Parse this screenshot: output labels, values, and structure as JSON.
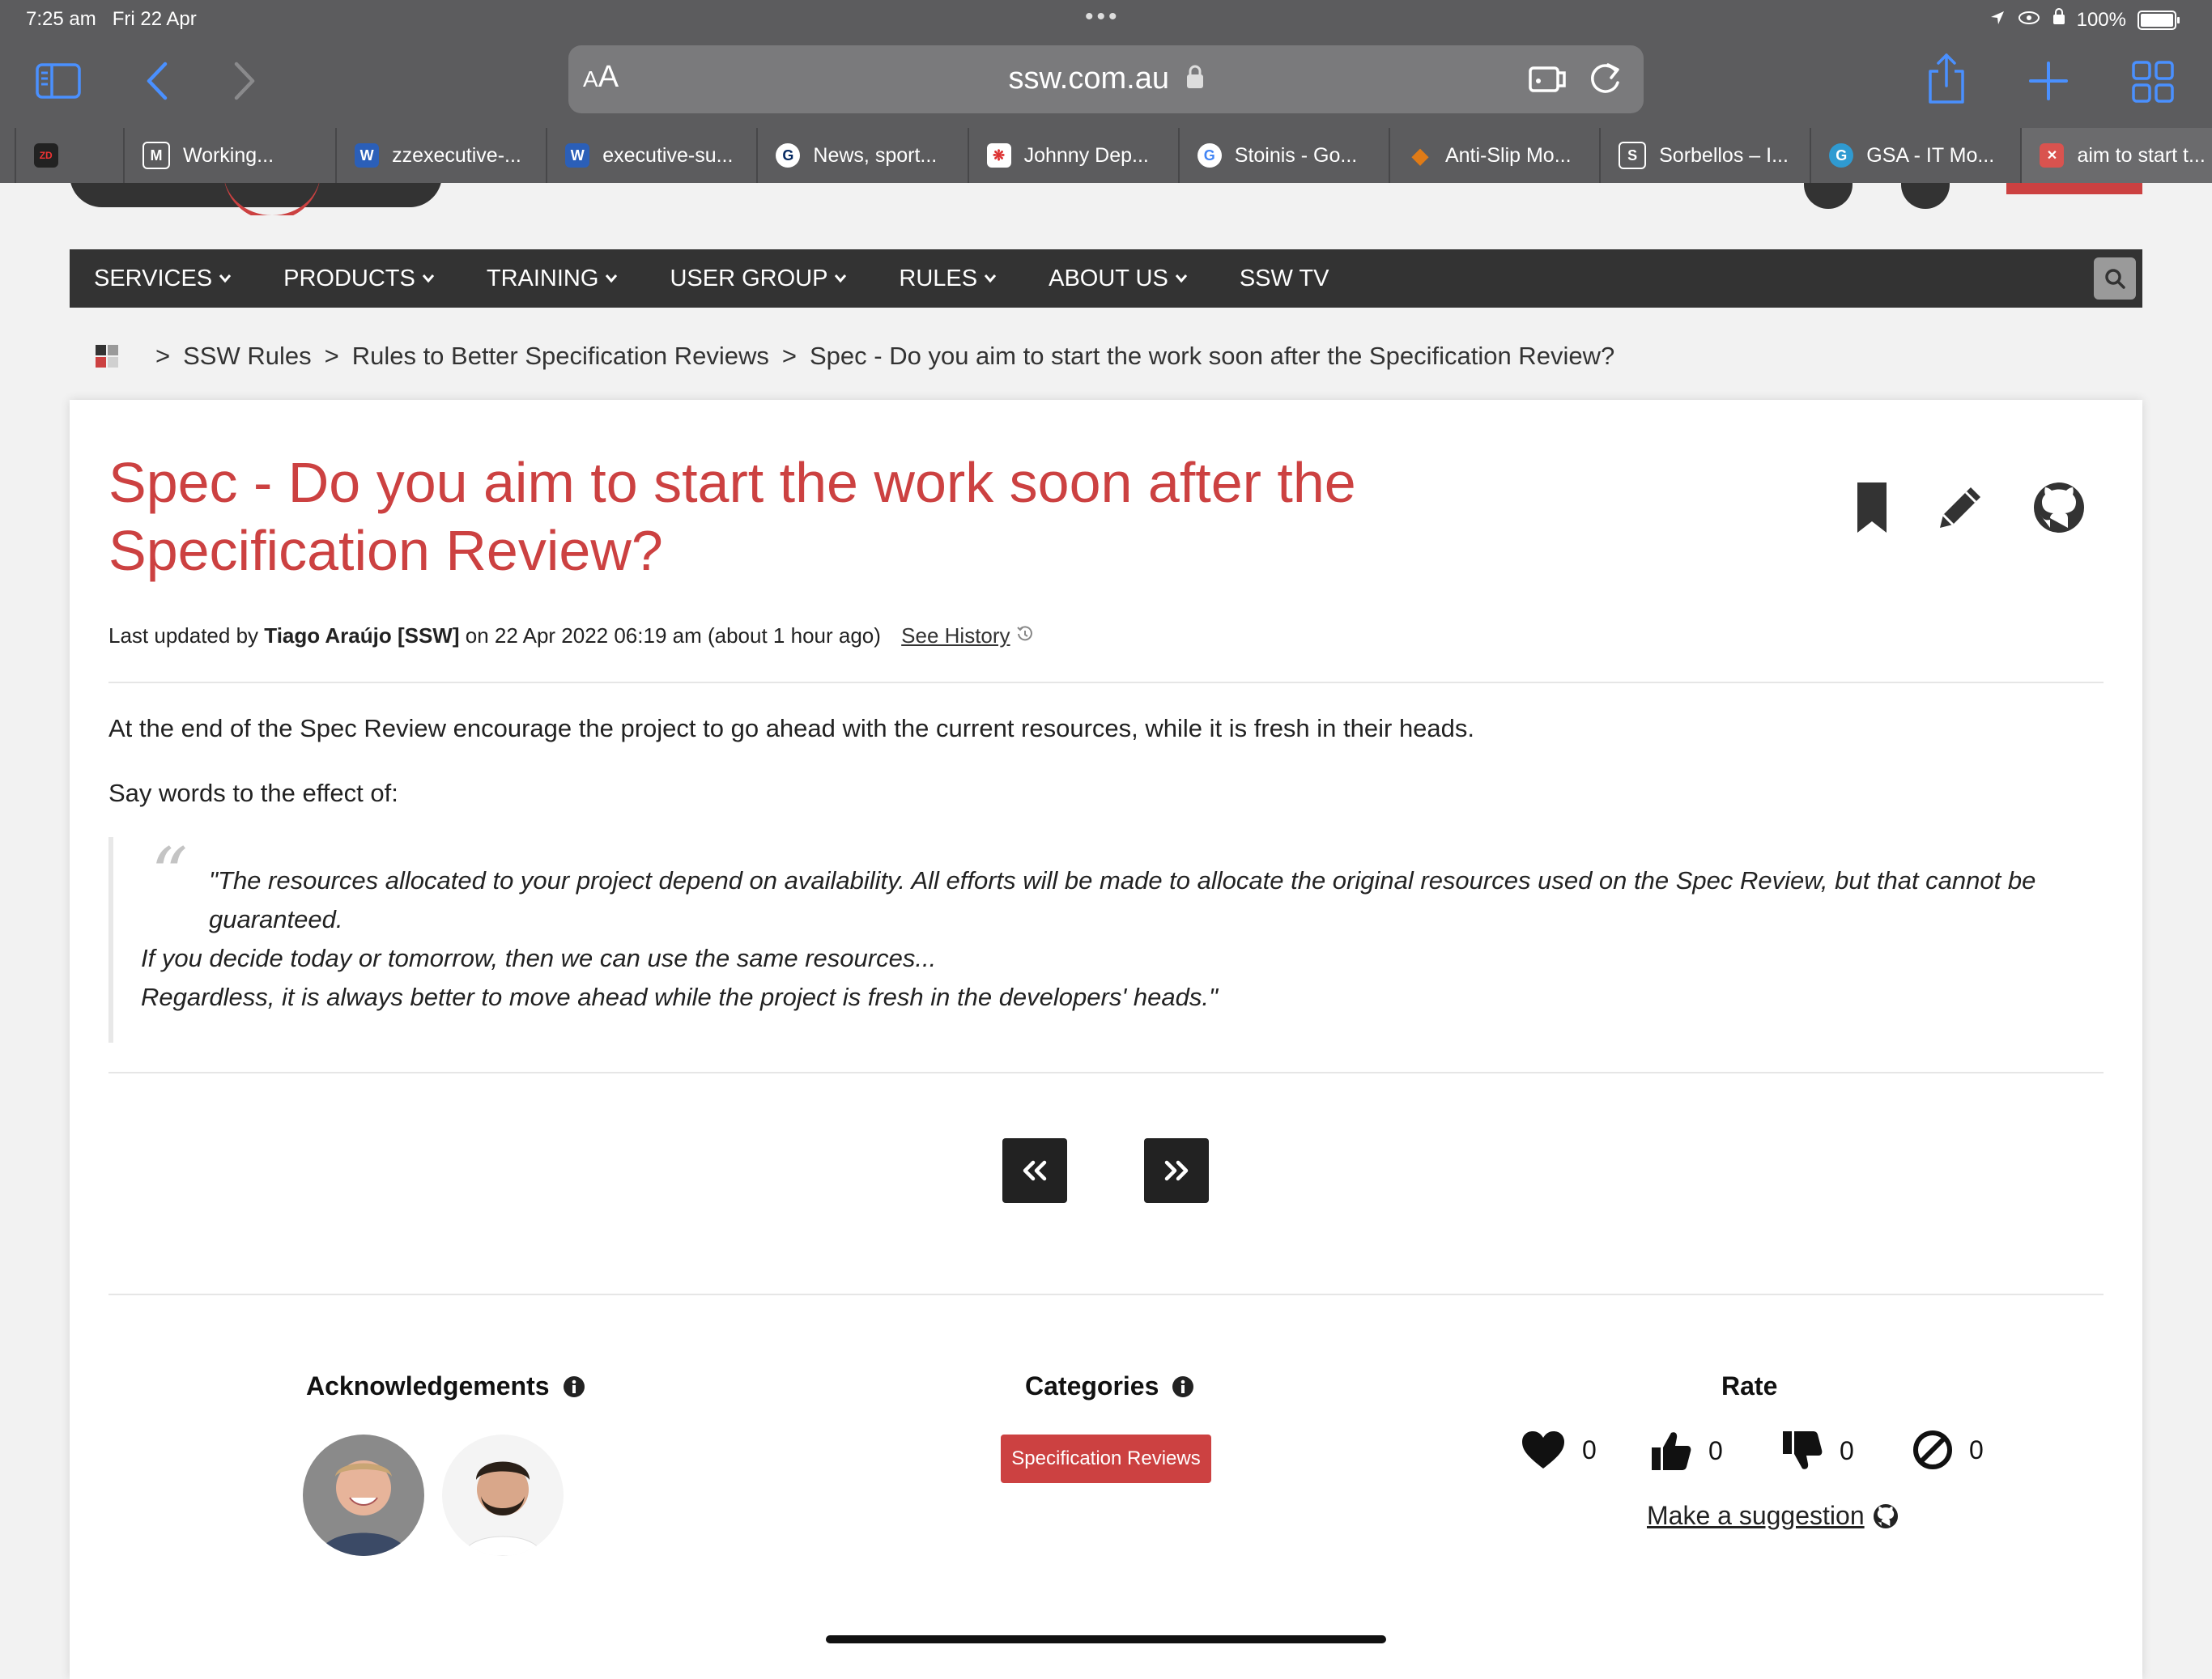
{
  "status": {
    "time": "7:25 am",
    "date": "Fri 22 Apr",
    "battery": "100%"
  },
  "browser": {
    "aa_label": "AA",
    "url": "ssw.com.au",
    "tabs": [
      {
        "label": "",
        "fav_color": "#222222",
        "fav_text": "ZD"
      },
      {
        "label": "Working...",
        "fav_color": "#ffffff",
        "fav_text": "M"
      },
      {
        "label": "zzexecutive-...",
        "fav_color": "#2b5fb8",
        "fav_text": "W"
      },
      {
        "label": "executive-su...",
        "fav_color": "#2b5fb8",
        "fav_text": "W"
      },
      {
        "label": "News, sport...",
        "fav_color": "#ffffff",
        "fav_text": "G"
      },
      {
        "label": "Johnny Dep...",
        "fav_color": "#ffffff",
        "fav_text": "❋"
      },
      {
        "label": "Stoinis - Go...",
        "fav_color": "#ffffff",
        "fav_text": "G"
      },
      {
        "label": "Anti-Slip Mo...",
        "fav_color": "#e07b16",
        "fav_text": "◆"
      },
      {
        "label": "Sorbellos – I...",
        "fav_color": "#ffffff",
        "fav_text": "S"
      },
      {
        "label": "GSA - IT Mo...",
        "fav_color": "#2f9ad1",
        "fav_text": "G"
      },
      {
        "label": "aim to start t...",
        "fav_color": "#d9534f",
        "fav_text": "✕"
      }
    ]
  },
  "nav": {
    "items": [
      "SERVICES",
      "PRODUCTS",
      "TRAINING",
      "USER GROUP",
      "RULES",
      "ABOUT US",
      "SSW TV"
    ]
  },
  "breadcrumb": {
    "items": [
      "SSW Rules",
      "Rules to Better Specification Reviews",
      "Spec - Do you aim to start the work soon after the Specification Review?"
    ],
    "sep": ">"
  },
  "rule": {
    "title_line1": "Spec - Do you aim to start the work soon after the",
    "title_line2": "Specification Review?",
    "meta_prefix": "Last updated by",
    "meta_author": "Tiago Araújo [SSW]",
    "meta_suffix": "on 22 Apr 2022 06:19 am (about 1 hour ago)",
    "see_history": "See History",
    "para1": "At the end of the Spec Review encourage the project to go ahead with the current resources, while it is fresh in their heads.",
    "para2": "Say words to the effect of:",
    "quote_mark": "“",
    "quote_line1": "\"The resources allocated to your project depend on availability. All efforts will be made to allocate the original resources used on the Spec Review, but that cannot be guaranteed.",
    "quote_line2": "If you decide today or tomorrow, then we can use the same resources...",
    "quote_line3": "Regardless, it is always better to move ahead while the project is fresh in the developers' heads.\""
  },
  "footer": {
    "ack_title": "Acknowledgements",
    "cat_title": "Categories",
    "rate_title": "Rate",
    "category": "Specification Reviews",
    "rates": [
      {
        "name": "love",
        "count": "0"
      },
      {
        "name": "like",
        "count": "0"
      },
      {
        "name": "dislike",
        "count": "0"
      },
      {
        "name": "disagree",
        "count": "0"
      }
    ],
    "suggestion": "Make a suggestion"
  },
  "colors": {
    "accent": "#cc4141",
    "nav_bg": "#333333",
    "chrome_bg": "#5c5c5e",
    "link_blue": "#4a90ff"
  }
}
